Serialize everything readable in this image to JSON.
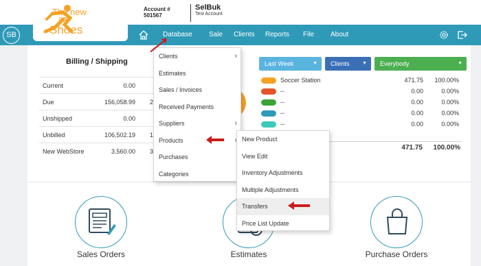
{
  "header": {
    "logo": {
      "line1": "The new",
      "line2": "age",
      "line3": "Shoes"
    },
    "account_label": "Account #",
    "account_number": "501567",
    "company_name": "SelBuk",
    "company_sub": "Test Account",
    "user_initials": "SB"
  },
  "nav": {
    "items": [
      {
        "label": "Database"
      },
      {
        "label": "Sale"
      },
      {
        "label": "Clients"
      },
      {
        "label": "Reports"
      },
      {
        "label": "File"
      },
      {
        "label": "About"
      }
    ]
  },
  "billing": {
    "title": "Billing / Shipping",
    "rows": [
      {
        "label": "Current",
        "value": "0.00",
        "clip": ""
      },
      {
        "label": "Due",
        "value": "156,058.99",
        "clip": "2"
      },
      {
        "label": "Unshipped",
        "value": "0.00",
        "clip": ""
      },
      {
        "label": "Unbilled",
        "value": "106,502.19",
        "clip": "1"
      },
      {
        "label": "New WebStore",
        "value": "3,560.00",
        "clip": "3"
      }
    ]
  },
  "filters": {
    "period": "Last Week",
    "group": "Clients",
    "scope": "Everybody"
  },
  "legend": [
    {
      "name": "Soccer Station",
      "amount": "471.75",
      "pct": "100.00%",
      "color": "#f4a226"
    },
    {
      "name": "--",
      "amount": "0.00",
      "pct": "0.00%",
      "color": "#e5542b"
    },
    {
      "name": "--",
      "amount": "0.00",
      "pct": "0.00%",
      "color": "#3aa537"
    },
    {
      "name": "--",
      "amount": "0.00",
      "pct": "0.00%",
      "color": "#2f9ab8"
    },
    {
      "name": "--",
      "amount": "0.00",
      "pct": "0.00%",
      "color": "#3cc9b9"
    }
  ],
  "totals": {
    "amount": "471.75",
    "pct": "100.00%"
  },
  "database_menu": [
    {
      "label": "Clients",
      "submenu": true
    },
    {
      "label": "Estimates",
      "submenu": false
    },
    {
      "label": "Sales / Invoices",
      "submenu": false
    },
    {
      "label": "Received Payments",
      "submenu": false
    },
    {
      "label": "Suppliers",
      "submenu": true
    },
    {
      "label": "Products",
      "submenu": true
    },
    {
      "label": "Purchases",
      "submenu": false
    },
    {
      "label": "Categories",
      "submenu": false
    }
  ],
  "products_menu": [
    {
      "label": "New Product"
    },
    {
      "label": "View Edit"
    },
    {
      "label": "Inventory Adjustments"
    },
    {
      "label": "Multiple Adjustments"
    },
    {
      "label": "Transfers"
    },
    {
      "label": "Price List Update"
    }
  ],
  "cards": [
    {
      "label": "Sales Orders"
    },
    {
      "label": "Estimates"
    },
    {
      "label": "Purchase Orders"
    }
  ],
  "colors": {
    "nav": "#2f9ab8",
    "accent": "#f4a226",
    "green_button": "#4caf50",
    "blue_button": "#3a6fb5",
    "light_blue_button": "#5ab4e0",
    "pointer_red": "#cc1b1b"
  }
}
